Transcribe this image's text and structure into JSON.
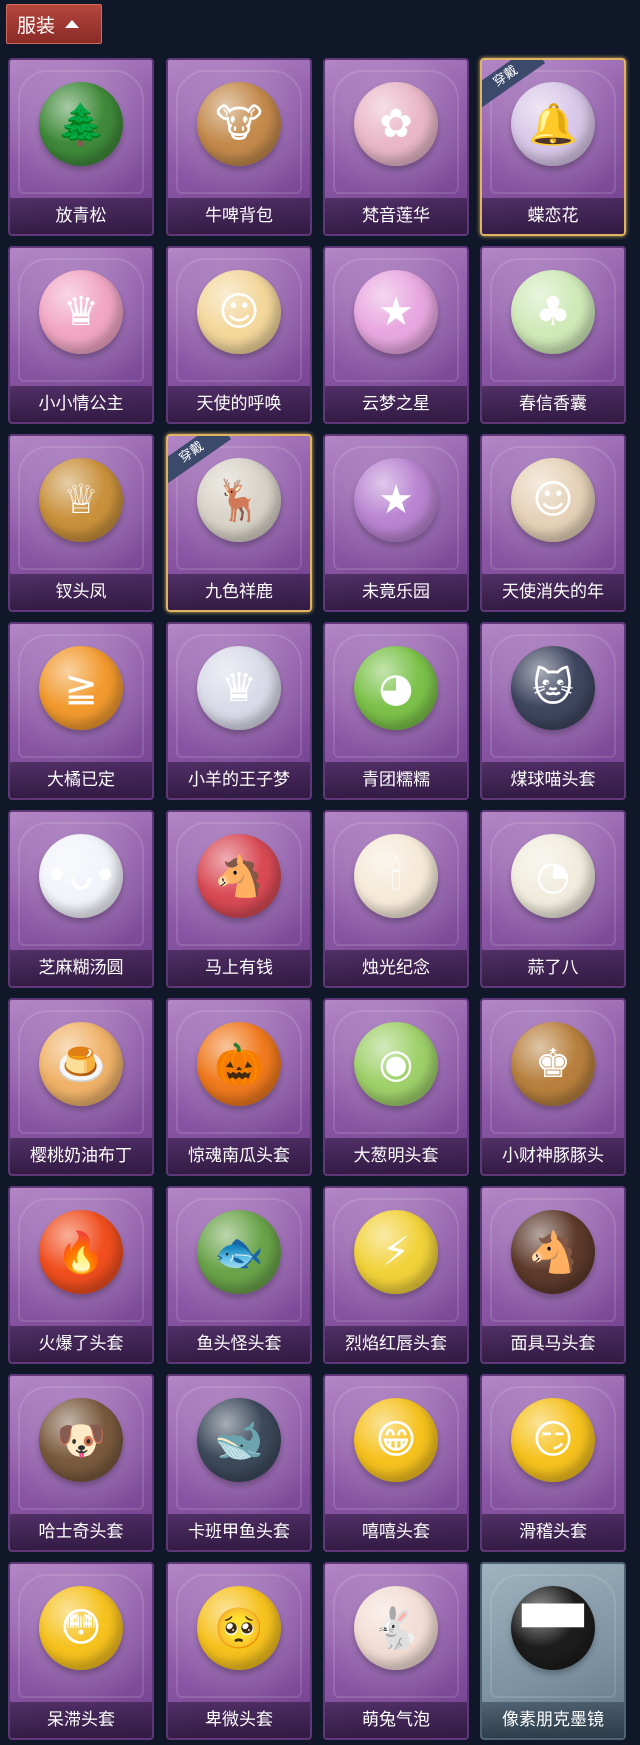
{
  "header": {
    "tab_label": "服装"
  },
  "badge_text": "穿戴",
  "items": [
    {
      "name": "放青松",
      "color": "#3f8a3a",
      "glyph": "🌲",
      "icon": "pine-bonsai-icon"
    },
    {
      "name": "牛啤背包",
      "color": "#c48a4c",
      "glyph": "🐮",
      "icon": "cow-beer-backpack-icon"
    },
    {
      "name": "梵音莲华",
      "color": "#e9b7c8",
      "glyph": "✿",
      "icon": "lotus-fairy-icon"
    },
    {
      "name": "蝶恋花",
      "color": "#d8c7e8",
      "glyph": "🔔",
      "icon": "butterfly-bell-icon",
      "equipped": true
    },
    {
      "name": "小小情公主",
      "color": "#f1a6c4",
      "glyph": "♛",
      "icon": "princess-icon"
    },
    {
      "name": "天使的呼唤",
      "color": "#f3d79b",
      "glyph": "☺",
      "icon": "angel-icon"
    },
    {
      "name": "云梦之星",
      "color": "#e8a7e0",
      "glyph": "★",
      "icon": "unicorn-cloud-icon"
    },
    {
      "name": "春信香囊",
      "color": "#cfe9b8",
      "glyph": "♣",
      "icon": "scent-pouch-icon"
    },
    {
      "name": "钗头凤",
      "color": "#c9913c",
      "glyph": "♕",
      "icon": "phoenix-crown-icon"
    },
    {
      "name": "九色祥鹿",
      "color": "#d8d3c8",
      "glyph": "🦌",
      "icon": "deer-icon",
      "equipped": true
    },
    {
      "name": "未竟乐园",
      "color": "#b984d1",
      "glyph": "★",
      "icon": "star-girl-icon"
    },
    {
      "name": "天使消失的年",
      "color": "#e6d2b8",
      "glyph": "☺",
      "icon": "veiled-angel-icon"
    },
    {
      "name": "大橘已定",
      "color": "#f29a2e",
      "glyph": "≧",
      "icon": "orange-face-icon"
    },
    {
      "name": "小羊的王子梦",
      "color": "#d9dbe8",
      "glyph": "♛",
      "icon": "sheep-prince-icon"
    },
    {
      "name": "青团糯糯",
      "color": "#7cc24a",
      "glyph": "◕",
      "icon": "green-dumpling-icon"
    },
    {
      "name": "煤球喵头套",
      "color": "#3f4660",
      "glyph": "🐱",
      "icon": "black-cat-icon"
    },
    {
      "name": "芝麻糊汤圆",
      "color": "#f2f4fb",
      "glyph": "•ᴗ•",
      "icon": "rice-ball-icon"
    },
    {
      "name": "马上有钱",
      "color": "#d94a55",
      "glyph": "🐴",
      "icon": "red-horse-icon"
    },
    {
      "name": "烛光纪念",
      "color": "#f6ead8",
      "glyph": "🕯",
      "icon": "candle-icon"
    },
    {
      "name": "蒜了八",
      "color": "#f1ecde",
      "glyph": "◔",
      "icon": "garlic-icon"
    },
    {
      "name": "樱桃奶油布丁",
      "color": "#f0b36a",
      "glyph": "🍮",
      "icon": "pudding-icon"
    },
    {
      "name": "惊魂南瓜头套",
      "color": "#f07a1e",
      "glyph": "🎃",
      "icon": "pumpkin-icon"
    },
    {
      "name": "大葱明头套",
      "color": "#9fd06a",
      "glyph": "◉",
      "icon": "scallion-icon"
    },
    {
      "name": "小财神豚豚头",
      "color": "#b8803e",
      "glyph": "♚",
      "icon": "capybara-god-icon"
    },
    {
      "name": "火爆了头套",
      "color": "#f04e1e",
      "glyph": "🔥",
      "icon": "fire-face-icon"
    },
    {
      "name": "鱼头怪头套",
      "color": "#6aa34a",
      "glyph": "🐟",
      "icon": "fish-head-icon"
    },
    {
      "name": "烈焰红唇头套",
      "color": "#f2d23a",
      "glyph": "⚡",
      "icon": "yellow-mouse-icon"
    },
    {
      "name": "面具马头套",
      "color": "#5e3a2b",
      "glyph": "🐴",
      "icon": "horse-mask-icon"
    },
    {
      "name": "哈士奇头套",
      "color": "#7a5a3e",
      "glyph": "🐶",
      "icon": "husky-icon"
    },
    {
      "name": "卡班甲鱼头套",
      "color": "#3d4a5c",
      "glyph": "🐋",
      "icon": "whale-icon"
    },
    {
      "name": "嘻嘻头套",
      "color": "#f6c21e",
      "glyph": "😁",
      "icon": "grin-emoji-icon"
    },
    {
      "name": "滑稽头套",
      "color": "#f6c21e",
      "glyph": "😏",
      "icon": "funny-emoji-icon"
    },
    {
      "name": "呆滞头套",
      "color": "#f6c21e",
      "glyph": "😳",
      "icon": "dazed-emoji-icon"
    },
    {
      "name": "卑微头套",
      "color": "#f6c21e",
      "glyph": "🥺",
      "icon": "humble-emoji-icon"
    },
    {
      "name": "萌兔气泡",
      "color": "#f3ddd5",
      "glyph": "🐇",
      "icon": "bunny-bubble-icon"
    },
    {
      "name": "像素朋克墨镜",
      "color": "#1d1d1d",
      "glyph": "▀▀",
      "icon": "pixel-sunglasses-icon",
      "plain": true
    }
  ]
}
